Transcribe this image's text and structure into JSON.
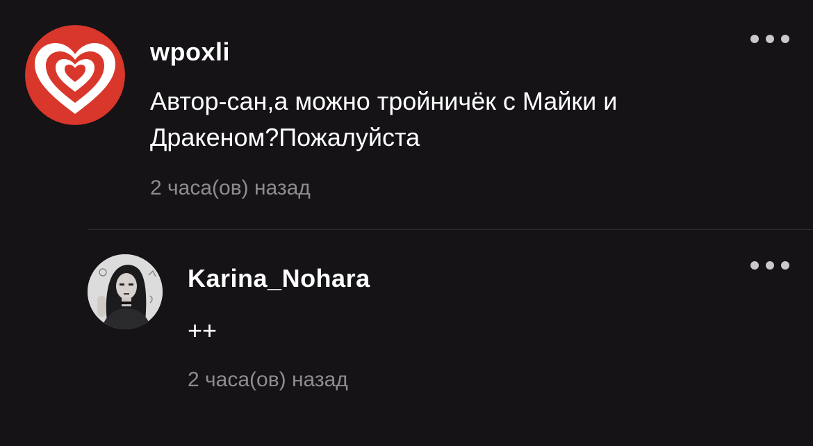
{
  "comments": [
    {
      "username": "wpoxli",
      "text": "Автор-сан,а можно тройничёк с Майки и Дракеном?Пожалуйста",
      "time": "2 часа(ов) назад",
      "avatar_icon": "heart-icon",
      "avatar_colors": {
        "bg": "#d9372b",
        "heart": "#ffffff"
      }
    },
    {
      "username": "Karina_Nohara",
      "text": "++",
      "time": "2 часа(ов) назад",
      "avatar_icon": "user-photo"
    }
  ],
  "more_icon": "more-dots-icon"
}
